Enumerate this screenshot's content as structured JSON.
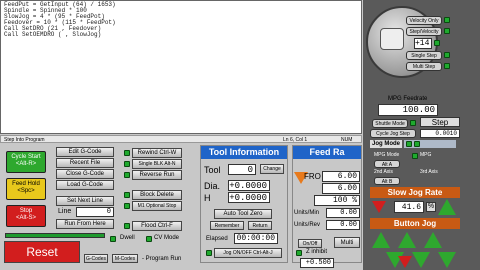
{
  "editor": {
    "lines": [
      "FeedPut = GetInput (64) / 1653)",
      "Spindle = Spinned * 100",
      "SlowJog = 4 * (95 * FeedPot)",
      "Feedover = 10 * (115 * FeedPot)",
      "Call SetDRO (21 , Feedover)",
      "Call SetOEMDRO ( , SlowJog)"
    ]
  },
  "statusbar": {
    "left": "Step Into Program",
    "ln": "Ln 6, Col 1",
    "num": "NUM"
  },
  "mpg": {
    "velocity_only": "Velocity Only",
    "step_velocity": "Step/Velocity",
    "step_value": "+14",
    "single_step": "Single Step",
    "multi_step": "Multi Step",
    "feedrate_label": "MPG Feedrate",
    "feedrate_value": "100.00",
    "shuttle_mode": "Shuttle Mode",
    "step": "Step",
    "cycle_jog_step": "Cycle Jog Step",
    "cycle_jog_value": "0.0010",
    "jog_mode": "Jog Mode",
    "mpg_mode": "MPG Mode",
    "alt_a": "Alt A",
    "alt_b": "Alt B",
    "mpg_label": "MPG",
    "two_nd": "2nd Axis",
    "three_rd": "3rd Axis",
    "slow_jog_rate": "Slow Jog Rate",
    "slow_jog_value": "41.6",
    "slow_jog_pct": "%",
    "button_jog": "Button Jog",
    "arrow_labels": [
      "-Y",
      "+Z",
      "+A",
      "+Z",
      "-Y",
      "-A"
    ]
  },
  "left": {
    "cycle_start": "Cycle Start",
    "cycle_start_key": "<Alt-R>",
    "feed_hold": "Feed Hold",
    "feed_hold_key": "<Spc>",
    "stop": "Stop",
    "stop_key": "<Alt-S>",
    "edit_gcode": "Edit G-Code",
    "recent_file": "Recent File",
    "close_gcode": "Close G-Code",
    "load_gcode": "Load G-Code",
    "set_next_line": "Set Next Line",
    "line_label": "Line",
    "line_value": "0",
    "run_from_here": "Run From Here",
    "reset": "Reset",
    "gcodes": "G-Codes",
    "mcodes": "M-Codes",
    "program_run": "- Program Run"
  },
  "mid": {
    "rewind": "Rewind Ctrl-W",
    "single_blk": "Single BLK Alt-N",
    "reverse_run": "Reverse Run",
    "block_delete": "Block Delete",
    "m1_optional": "M1 Optional Stop",
    "flood": "Flood Ctrl-F",
    "dwell": "Dwell",
    "cv_mode": "CV Mode"
  },
  "tool": {
    "header": "Tool Information",
    "tool_label": "Tool",
    "tool_value": "0",
    "change": "Change",
    "dia_label": "Dia.",
    "dia_value": "+0.0000",
    "h_label": "H",
    "h_value": "+0.0000",
    "auto_tool_zero": "Auto Tool Zero",
    "remember": "Remember",
    "return": "Return",
    "elapsed_label": "Elapsed",
    "elapsed_value": "00:00:00",
    "jog_onoff": "Jog ON/OFF Ctrl-Alt-J"
  },
  "feed": {
    "header": "Feed Ra",
    "fro_label": "FRO",
    "fro_value": "6.00",
    "feed_value": "6.00",
    "pct_value": "100 %",
    "units_min": "Units/Min",
    "units_min_value": "0.00",
    "units_rev": "Units/Rev",
    "units_rev_value": "0.00",
    "onoff": "On/Off",
    "multi": "Multi",
    "z_inhibit": "Z inhibit",
    "z_inhibit_value": "+0.500"
  },
  "colors": {
    "accent_blue": "#1f64c8",
    "green": "#2ea82e",
    "red": "#d21e1e",
    "orange": "#e87a1c"
  }
}
